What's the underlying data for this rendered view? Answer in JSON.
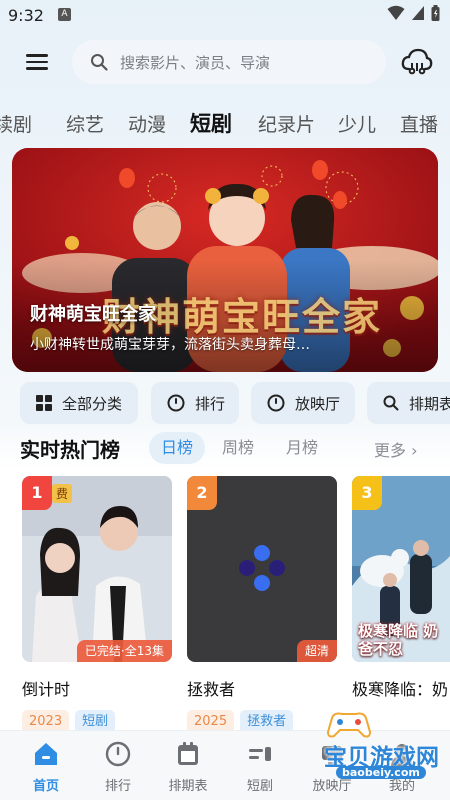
{
  "status_bar": {
    "time": "9:32",
    "notif_letter": "A"
  },
  "header": {
    "search_placeholder": "搜索影片、演员、导演"
  },
  "category_tabs": [
    "续剧",
    "综艺",
    "动漫",
    "短剧",
    "纪录片",
    "少儿",
    "直播"
  ],
  "active_category": "短剧",
  "banner": {
    "title": "财神萌宝旺全家",
    "subtitle": "小财神转世成萌宝芽芽，流落街头卖身葬母…",
    "logo_text": "财神萌宝旺全家"
  },
  "quick_buttons": [
    {
      "label": "全部分类",
      "icon": "grid-icon"
    },
    {
      "label": "排行",
      "icon": "circle-icon"
    },
    {
      "label": "放映厅",
      "icon": "circle-icon"
    },
    {
      "label": "排期表",
      "icon": "search-icon"
    }
  ],
  "hot_section": {
    "title": "实时热门榜",
    "tabs": [
      "日榜",
      "周榜",
      "月榜"
    ],
    "active_tab": "日榜",
    "more": "更多"
  },
  "cards": [
    {
      "rank": "1",
      "title": "倒计时",
      "status": "已完结·全13集",
      "year": "2023",
      "kind": "短剧",
      "poster_corner": "费",
      "badge_color": "#f0463f"
    },
    {
      "rank": "2",
      "title": "拯救者",
      "status": "超清",
      "year": "2025",
      "kind": "拯救者",
      "badge_color": "#f2883a"
    },
    {
      "rank": "3",
      "title": "极寒降临：奶",
      "status": "",
      "year": "",
      "kind": "",
      "poster_text": "极寒降临 奶爸不忍",
      "badge_color": "#f5c018"
    }
  ],
  "bottom_nav": [
    {
      "label": "首页",
      "icon": "home-icon",
      "active": true
    },
    {
      "label": "排行",
      "icon": "circle-icon",
      "active": false
    },
    {
      "label": "排期表",
      "icon": "calendar-icon",
      "active": false
    },
    {
      "label": "短剧",
      "icon": "drama-icon",
      "active": false
    },
    {
      "label": "放映厅",
      "icon": "theater-icon",
      "active": false
    },
    {
      "label": "我的",
      "icon": "profile-icon",
      "active": false
    }
  ],
  "watermark": {
    "text": "宝贝游戏网",
    "url": "baobeiy.com"
  },
  "colors": {
    "accent": "#2f8de4",
    "rank1": "#f0463f",
    "rank2": "#f2883a",
    "rank3": "#f5c018"
  }
}
